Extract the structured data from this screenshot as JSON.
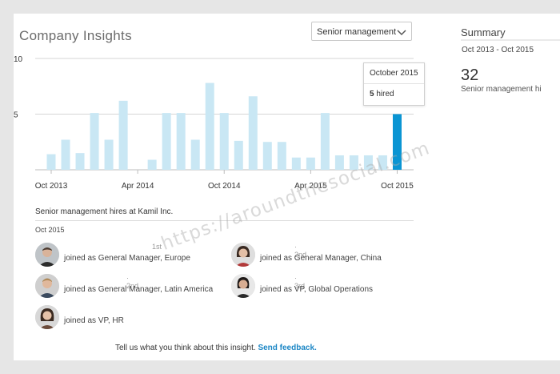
{
  "header": {
    "title": "Company Insights",
    "dropdown_selected": "Senior management"
  },
  "summary": {
    "title": "Summary",
    "range": "Oct 2013 - Oct 2015",
    "count": "32",
    "label": "Senior management hi"
  },
  "chart_data": {
    "type": "bar",
    "y_ticks": [
      "10",
      "5"
    ],
    "ylim": [
      0,
      10
    ],
    "x_tick_labels": [
      "Oct 2013",
      "Apr 2014",
      "Oct 2014",
      "Apr 2015",
      "Oct 2015"
    ],
    "categories": [
      "Oct 2013",
      "Nov 2013",
      "Dec 2013",
      "Jan 2014",
      "Feb 2014",
      "Mar 2014",
      "Apr 2014",
      "May 2014",
      "Jun 2014",
      "Jul 2014",
      "Aug 2014",
      "Sep 2014",
      "Oct 2014",
      "Nov 2014",
      "Dec 2014",
      "Jan 2015",
      "Feb 2015",
      "Mar 2015",
      "Apr 2015",
      "May 2015",
      "Jun 2015",
      "Jul 2015",
      "Aug 2015",
      "Sep 2015",
      "Oct 2015"
    ],
    "values": [
      1.4,
      2.7,
      1.5,
      5.1,
      2.7,
      6.2,
      0,
      0.9,
      5.1,
      5.1,
      2.7,
      7.8,
      5.1,
      2.6,
      6.6,
      2.5,
      2.5,
      1.1,
      1.1,
      5.1,
      1.3,
      1.3,
      1.3,
      1.3,
      5.0
    ],
    "highlight_index": 24,
    "colors": {
      "bar": "#c9e7f4",
      "highlight": "#0a95d3",
      "grid": "#d6d6d6"
    },
    "grid": true
  },
  "tooltip": {
    "month": "October 2015",
    "count": "5",
    "hired_text": "hired"
  },
  "hires": {
    "title": "Senior management hires at Kamil Inc.",
    "month": "Oct 2015",
    "items": [
      {
        "rank": "1st",
        "desc": "joined as General Manager, Europe",
        "avatar_icon": "man-portrait-icon"
      },
      {
        "rank": "· 2nd",
        "desc": "joined as General Manager, China",
        "avatar_icon": "woman-portrait-icon"
      },
      {
        "rank": "· 2nd",
        "desc": "joined as General Manager, Latin America",
        "avatar_icon": "man-portrait-icon"
      },
      {
        "rank": "· 3rd",
        "desc": "joined as VP, Global Operations",
        "avatar_icon": "woman-portrait-icon"
      },
      {
        "rank": "",
        "desc": "joined as VP, HR",
        "avatar_icon": "woman-portrait-icon"
      }
    ]
  },
  "feedback": {
    "prompt": "Tell us what you think about this insight.",
    "link": "Send feedback."
  },
  "watermark": "https://aroundthesocial.com"
}
